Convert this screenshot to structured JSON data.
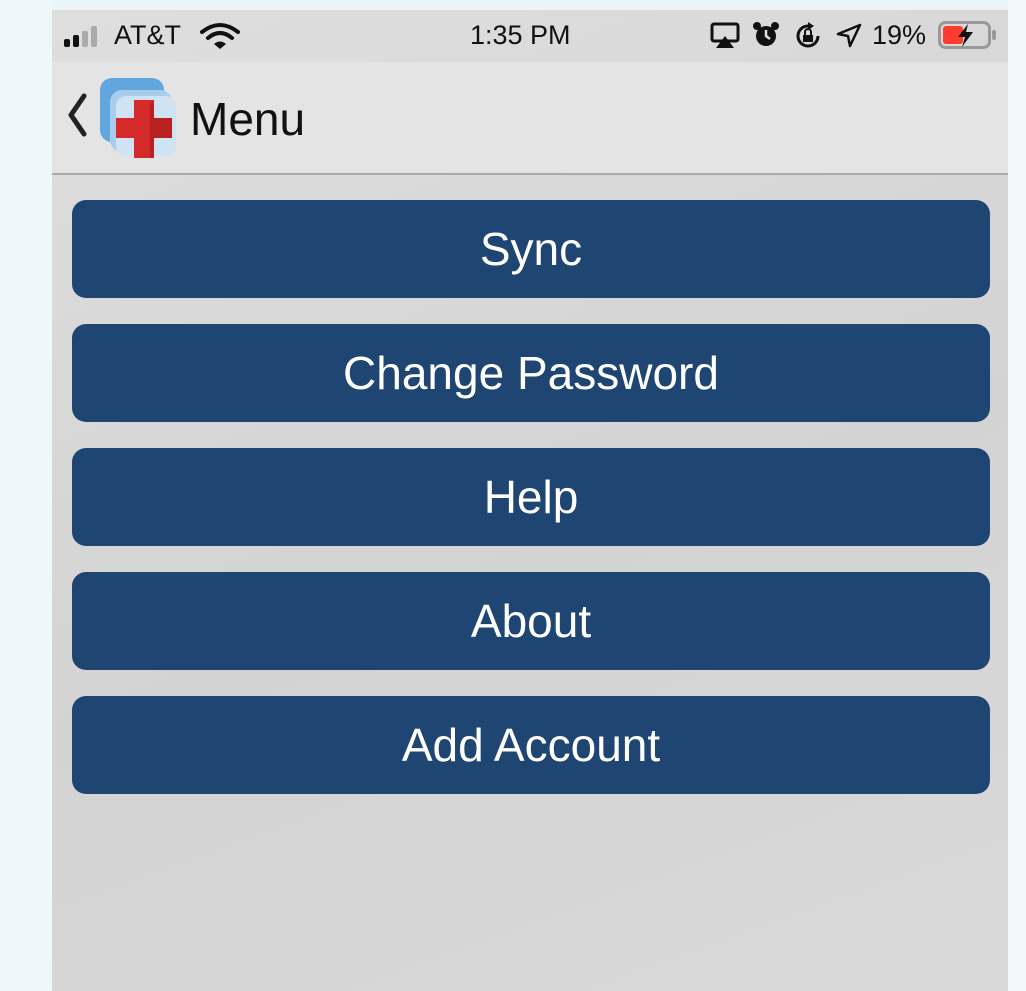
{
  "status_bar": {
    "carrier": "AT&T",
    "time": "1:35 PM",
    "battery_percent": "19%",
    "battery_level": 0.19,
    "icons": [
      "signal-icon",
      "wifi-icon",
      "airplay-icon",
      "alarm-icon",
      "rotation-lock-icon",
      "location-icon",
      "battery-charging-icon"
    ]
  },
  "nav": {
    "back_icon": "chevron-left-icon",
    "logo_icon": "medical-cross-app-icon",
    "title": "Menu"
  },
  "menu": {
    "items": [
      {
        "label": "Sync"
      },
      {
        "label": "Change Password"
      },
      {
        "label": "Help"
      },
      {
        "label": "About"
      },
      {
        "label": "Add Account"
      }
    ]
  },
  "colors": {
    "button_bg": "#1f4572",
    "button_text": "#ffffff",
    "logo_blue": "#5fa3dd",
    "logo_red": "#d42a2a",
    "battery_low": "#ff3b30"
  }
}
